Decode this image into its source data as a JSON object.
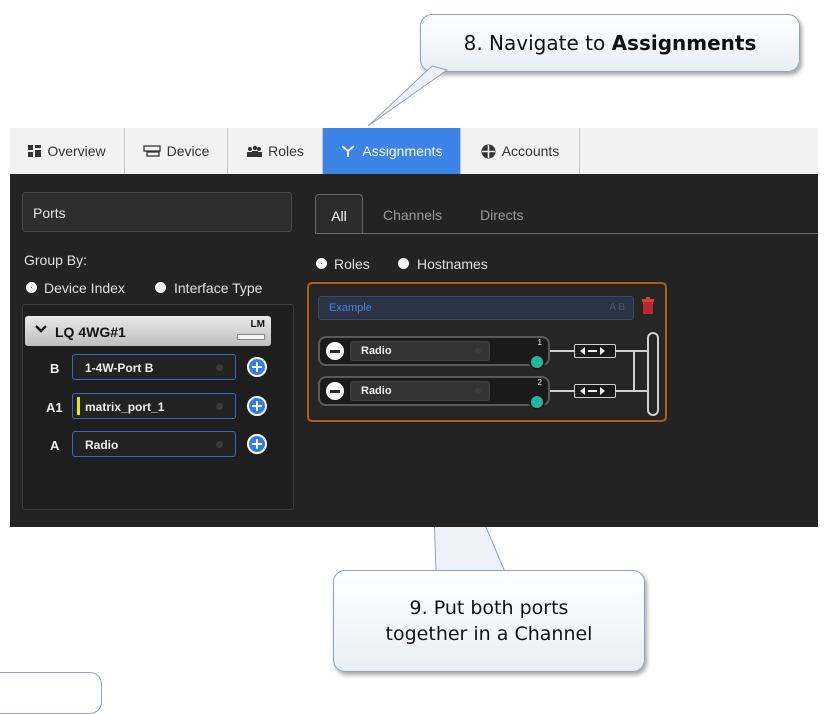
{
  "callouts": {
    "step8_prefix": "8. Navigate to ",
    "step8_bold": "Assignments",
    "step9_line1": "9. Put both ports",
    "step9_line2": "together in a Channel"
  },
  "tabs": [
    {
      "label": "Overview",
      "icon": "grid-icon"
    },
    {
      "label": "Device",
      "icon": "device-icon"
    },
    {
      "label": "Roles",
      "icon": "users-icon"
    },
    {
      "label": "Assignments",
      "icon": "assignments-icon",
      "active": true
    },
    {
      "label": "Accounts",
      "icon": "accounts-icon"
    }
  ],
  "ports_panel": {
    "title": "Ports",
    "group_by_label": "Group By:",
    "group_options": [
      {
        "label": "Device Index",
        "selected": true
      },
      {
        "label": "Interface Type",
        "selected": false
      }
    ],
    "device": {
      "name": "LQ 4WG#1",
      "badge": "LM"
    },
    "rows": [
      {
        "index": "B",
        "port": "1-4W-Port B"
      },
      {
        "index": "A1",
        "port": "matrix_port_1"
      },
      {
        "index": "A",
        "port": "Radio"
      }
    ]
  },
  "channels_panel": {
    "subtabs": [
      "All",
      "Channels",
      "Directs"
    ],
    "active_subtab": "All",
    "view_options": [
      {
        "label": "Roles",
        "selected": true
      },
      {
        "label": "Hostnames",
        "selected": false
      }
    ],
    "channel": {
      "name": "Example",
      "badges": "A B",
      "members": [
        {
          "label": "Radio",
          "number": "1"
        },
        {
          "label": "Radio",
          "number": "2"
        }
      ]
    }
  },
  "colors": {
    "accent": "#3b83e6",
    "channel_border": "#b05e18",
    "port_border": "#3c66c4",
    "app_background": "#232323"
  }
}
